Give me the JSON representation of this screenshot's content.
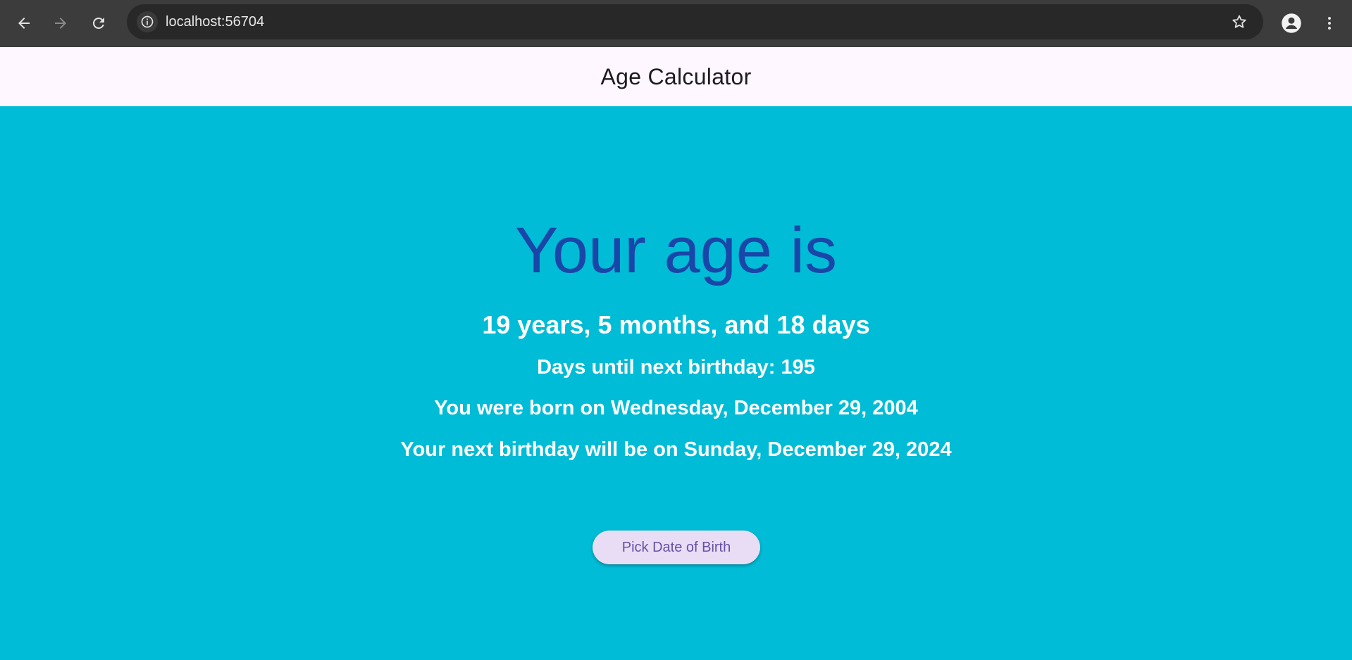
{
  "browser": {
    "url": "localhost:56704",
    "icons": {
      "back": "arrow-left-icon",
      "forward": "arrow-right-icon",
      "reload": "reload-icon",
      "info": "info-icon",
      "bookmark": "star-icon",
      "profile": "person-icon",
      "menu": "more-vertical-icon"
    }
  },
  "app_bar": {
    "title": "Age Calculator"
  },
  "main": {
    "headline": "Your age is",
    "age": "19 years, 5 months, and 18 days",
    "days_until_birthday": "Days until next birthday: 195",
    "born_on": "You were born on Wednesday, December 29, 2004",
    "next_birthday": "Your next birthday will be on Sunday, December 29, 2024",
    "pick_button_label": "Pick Date of Birth"
  },
  "colors": {
    "background": "#00BCD6",
    "headline": "#1946A8",
    "app_bar": "#FEF7FF",
    "button_bg": "#E9DDF5",
    "button_text": "#6750A4",
    "text": "#FFFFFF"
  }
}
